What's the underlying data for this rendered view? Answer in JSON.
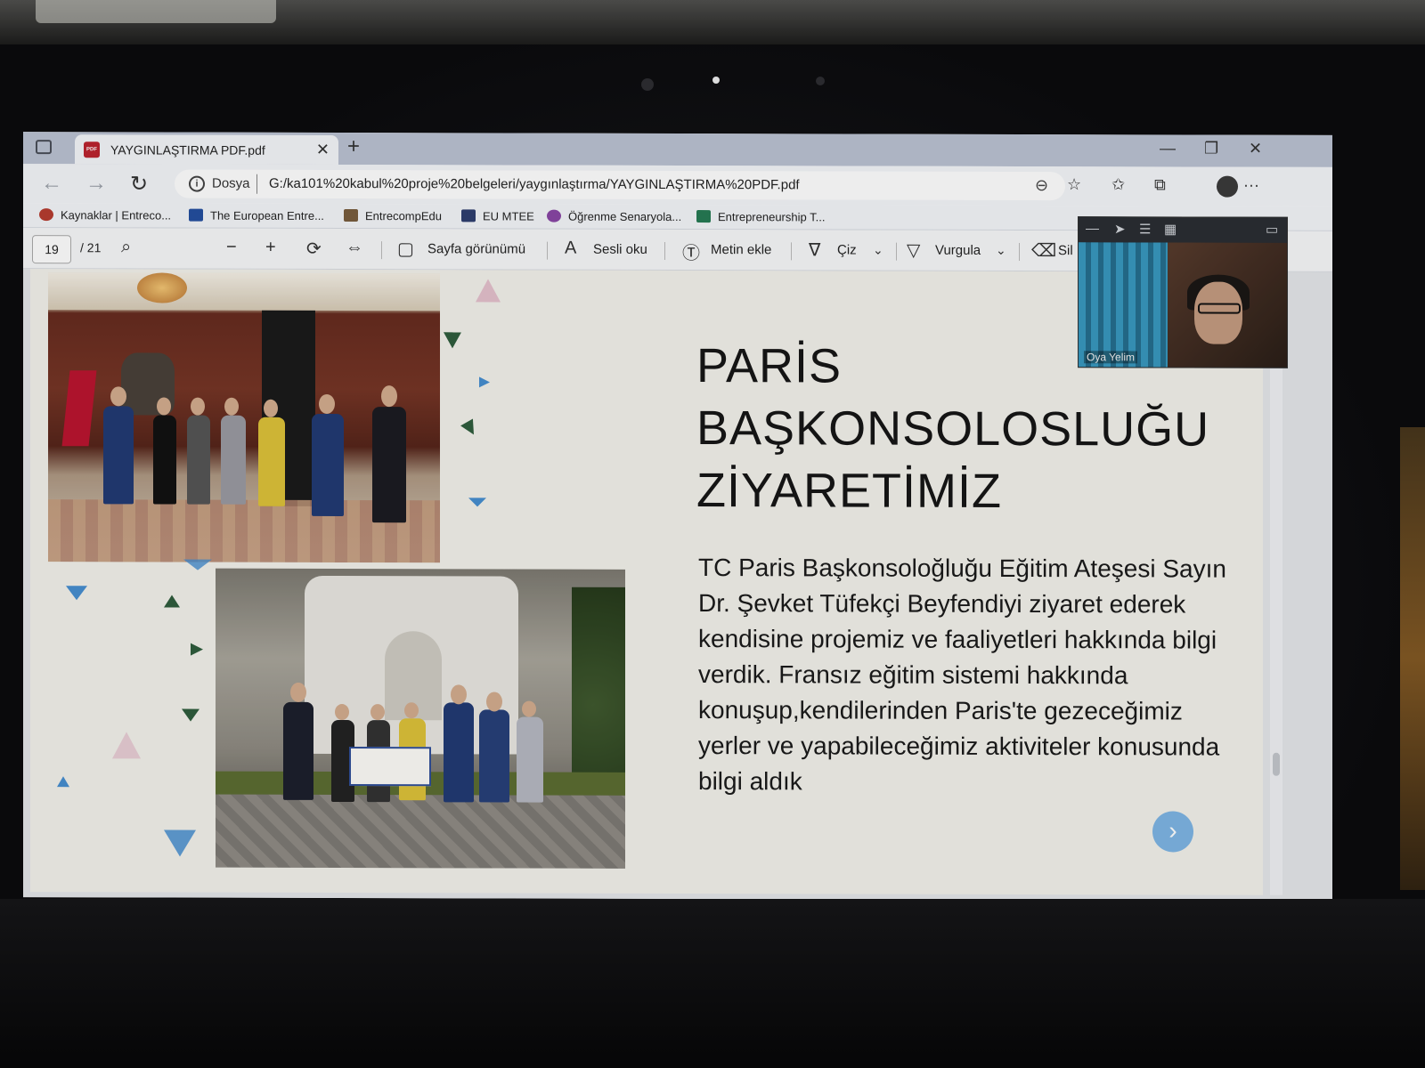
{
  "browser": {
    "tab_title": "YAYGINLAŞTIRMA PDF.pdf",
    "tab_close": "✕",
    "new_tab": "+",
    "window_controls": [
      "—",
      "❐",
      "✕"
    ],
    "address": {
      "scheme_label": "Dosya",
      "url": "G:/ka101%20kabul%20proje%20belgeleri/yaygınlaştırma/YAYGINLAŞTIRMA%20PDF.pdf"
    },
    "bookmarks": [
      {
        "label": "Kaynaklar | Entreco...",
        "icon_color": "#c0392b"
      },
      {
        "label": "The European Entre...",
        "icon_color": "#1f4fa8"
      },
      {
        "label": "EntrecompEdu",
        "icon_color": "#7b5c3a"
      },
      {
        "label": "EU MTEE",
        "icon_color": "#2c3e74"
      },
      {
        "label": "Öğrenme Senaryola...",
        "icon_color": "#8e44ad"
      },
      {
        "label": "Entrepreneurship T...",
        "icon_color": "#1e7d52"
      }
    ]
  },
  "pdf_toolbar": {
    "page_current": "19",
    "page_total": "/ 21",
    "page_view": "Sayfa görünümü",
    "read_aloud": "Sesli oku",
    "add_text": "Metin ekle",
    "draw": "Çiz",
    "highlight": "Vurgula",
    "erase": "Sil"
  },
  "slide": {
    "title_lines": [
      "PARİS",
      "BAŞKONSOLOSLUĞU",
      "ZİYARETİMİZ"
    ],
    "body": "TC Paris Başkonsoloğluğu Eğitim Ateşesi Sayın Dr. Şevket Tüfekçi Beyfendiyi ziyaret ederek kendisine projemiz ve faaliyetleri hakkında bilgi verdik. Fransız eğitim sistemi hakkında konuşup,kendilerinden Paris'te gezeceğimiz yerler ve yapabileceğimiz aktiviteler konusunda bilgi aldık",
    "next_glyph": "›"
  },
  "video_call": {
    "participant_name": "Oya Yelim"
  },
  "colors": {
    "tabbar": "#b9c2d4",
    "accent_next": "#79b6ea",
    "pdf_icon": "#c8202c"
  }
}
